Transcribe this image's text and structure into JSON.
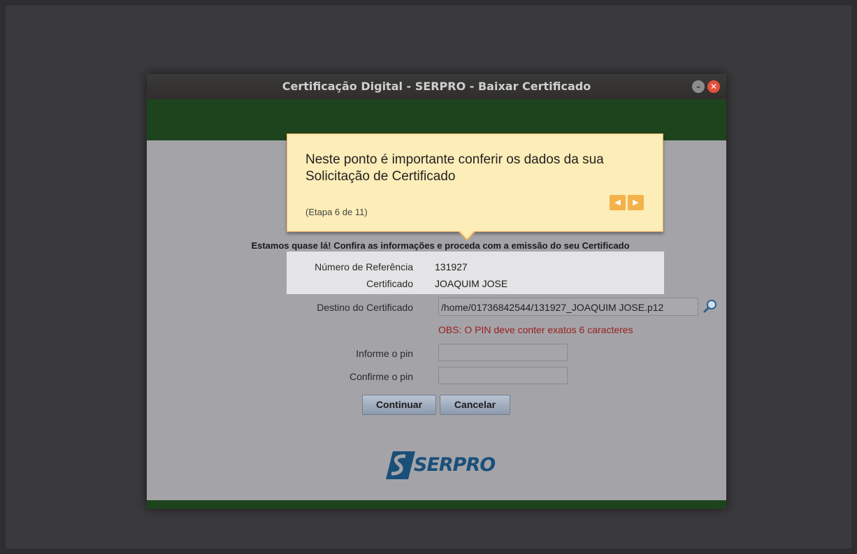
{
  "window": {
    "title": "Certificação Digital - SERPRO - Baixar Certificado",
    "min_glyph": "–",
    "close_glyph": "✕"
  },
  "tooltip": {
    "message": "Neste ponto é importante conferir os dados da sua Solicitação de Certificado",
    "step": "(Etapa 6 de 11)",
    "prev_glyph": "◀",
    "next_glyph": "▶"
  },
  "form": {
    "heading": "Estamos quase lá! Confira as informações e proceda com a emissão do seu Certificado",
    "reference_label": "Número de Referência",
    "reference_value": "131927",
    "certificate_label": "Certificado",
    "certificate_value": "JOAQUIM JOSE",
    "destination_label": "Destino do Certificado",
    "destination_value": "/home/01736842544/131927_JOAQUIM JOSE.p12",
    "obs": "OBS: O PIN deve conter exatos 6 caracteres",
    "pin_label": "Informe o pin",
    "pin_value": "",
    "confirm_pin_label": "Confirme o pin",
    "confirm_pin_value": "",
    "continue_label": "Continuar",
    "cancel_label": "Cancelar"
  },
  "logo": {
    "text": "SERPRO"
  },
  "colors": {
    "header_green": "#1e441e",
    "tooltip_bg": "#fdedb8",
    "nav_orange": "#f3b24a",
    "obs_red": "#9a1d1d",
    "logo_blue": "#1a4f7a"
  }
}
